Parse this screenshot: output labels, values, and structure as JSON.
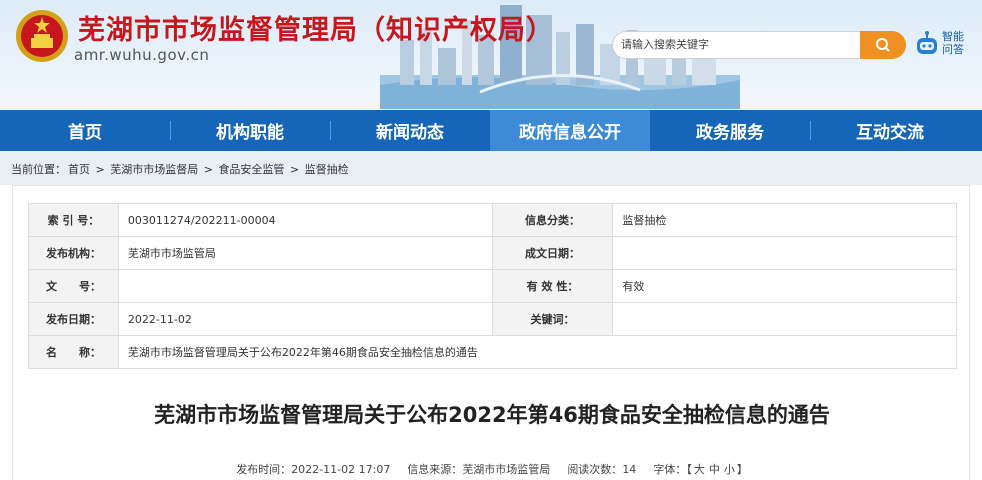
{
  "header": {
    "title": "芜湖市市场监督管理局（知识产权局）",
    "domain": "amr.wuhu.gov.cn",
    "search_placeholder": "请输入搜索关键字",
    "robot_label": "智能问答",
    "colors": {
      "title": "#c8161d",
      "nav": "#1565b8",
      "nav_active": "#3d8ad6",
      "search_button": "#f08f22"
    }
  },
  "nav": {
    "items": [
      "首页",
      "机构职能",
      "新闻动态",
      "政府信息公开",
      "政务服务",
      "互动交流"
    ],
    "active_index": 3
  },
  "breadcrumb": {
    "prefix": "当前位置：",
    "items": [
      "首页",
      "芜湖市市场监督局",
      "食品安全监管",
      "监督抽检"
    ],
    "separator": ">"
  },
  "meta_table": {
    "index_no_label": "索 引 号：",
    "index_no": "003011274/202211-00004",
    "info_category_label": "信息分类：",
    "info_category": "监督抽检",
    "publisher_label": "发布机构：",
    "publisher": "芜湖市市场监管局",
    "written_date_label": "成文日期：",
    "written_date": "",
    "doc_no_label": "文　　号：",
    "doc_no": "",
    "validity_label": "有 效 性：",
    "validity": "有效",
    "publish_date_label": "发布日期：",
    "publish_date": "2022-11-02",
    "keywords_label": "关键词：",
    "keywords": "",
    "name_label": "名　　称：",
    "name": "芜湖市市场监督管理局关于公布2022年第46期食品安全抽检信息的通告"
  },
  "article": {
    "title": "芜湖市市场监督管理局关于公布2022年第46期食品安全抽检信息的通告",
    "publish_time_label": "发布时间：",
    "publish_time": "2022-11-02 17:07",
    "source_label": "信息来源：",
    "source": "芜湖市市场监管局",
    "read_count_label": "阅读次数：",
    "read_count": "14",
    "font_label": "字体：",
    "font_open": "【",
    "font_large": "大",
    "font_medium": "中",
    "font_small": "小",
    "font_close": "】"
  },
  "icons": [
    "national-emblem-icon",
    "search-icon",
    "robot-icon"
  ]
}
